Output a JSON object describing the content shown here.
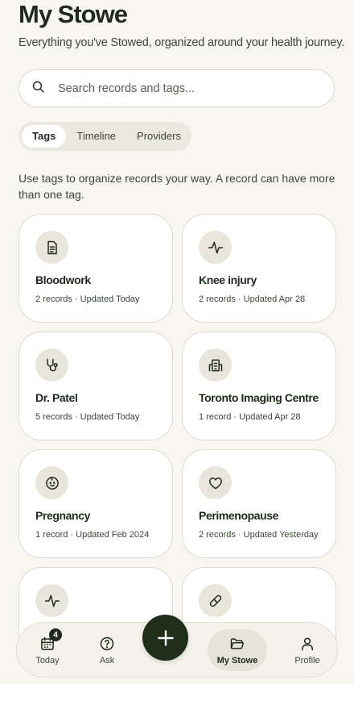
{
  "header": {
    "title": "My Stowe",
    "subtitle": "Everything you've Stowed, organized around your health journey."
  },
  "search": {
    "placeholder": "Search records and tags..."
  },
  "tabs": [
    {
      "label": "Tags",
      "active": true
    },
    {
      "label": "Timeline",
      "active": false
    },
    {
      "label": "Providers",
      "active": false
    }
  ],
  "hint": "Use tags to organize records your way. A record can have more than one tag.",
  "tags": [
    {
      "name": "Bloodwork",
      "meta": "2 records · Updated Today",
      "icon": "document-icon"
    },
    {
      "name": "Knee injury",
      "meta": "2 records · Updated Apr 28",
      "icon": "pulse-icon"
    },
    {
      "name": "Dr. Patel",
      "meta": "5 records · Updated Today",
      "icon": "stethoscope-icon"
    },
    {
      "name": "Toronto Imaging Centre",
      "meta": "1 record · Updated Apr 28",
      "icon": "hospital-icon"
    },
    {
      "name": "Pregnancy",
      "meta": "1 record · Updated Feb 2024",
      "icon": "baby-icon"
    },
    {
      "name": "Perimenopause",
      "meta": "2 records · Updated Yesterday",
      "icon": "heart-icon"
    },
    {
      "name": "",
      "meta": "",
      "icon": "pulse-icon"
    },
    {
      "name": "",
      "meta": "",
      "icon": "pill-icon"
    }
  ],
  "nav": {
    "today": {
      "label": "Today",
      "badge": "4",
      "icon": "calendar-icon"
    },
    "ask": {
      "label": "Ask",
      "icon": "help-icon"
    },
    "add": {
      "icon": "plus-icon"
    },
    "mystowe": {
      "label": "My Stowe",
      "icon": "folder-icon",
      "active": true
    },
    "profile": {
      "label": "Profile",
      "icon": "user-icon"
    }
  },
  "colors": {
    "background": "#f8f6f0",
    "accent_dark": "#1f2f1c",
    "card": "#ffffff",
    "icon_bg": "#e8e5da"
  }
}
